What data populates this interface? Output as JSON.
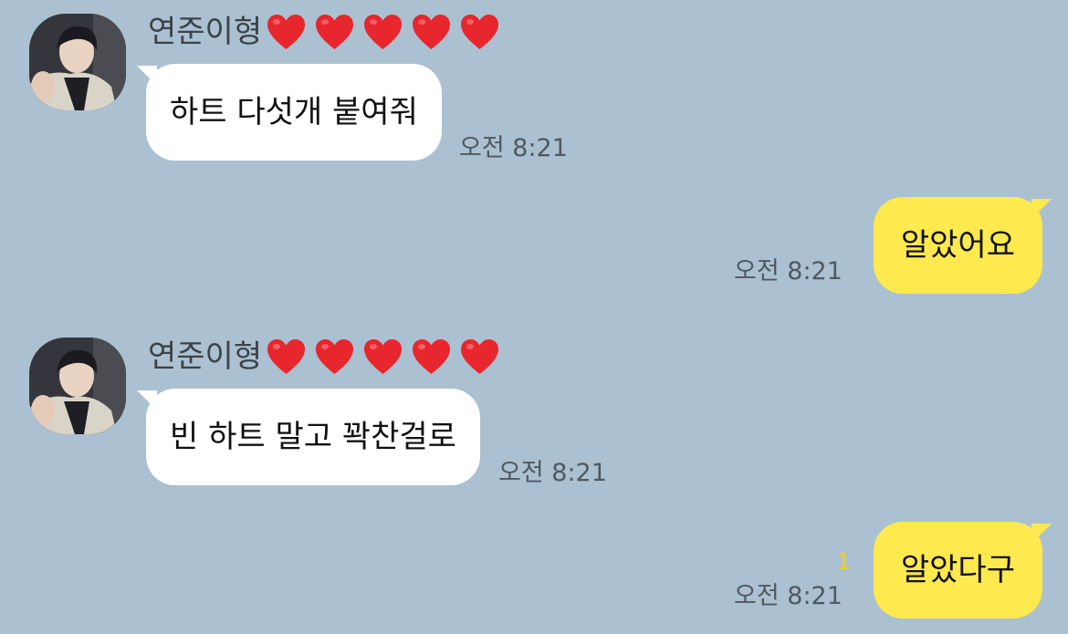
{
  "sender": {
    "name": "연준이형",
    "heart_count": 5,
    "heart_color": "#e8262d"
  },
  "messages": [
    {
      "direction": "in",
      "text": "하트 다섯개 붙여줘",
      "time": "오전 8:21"
    },
    {
      "direction": "out",
      "text": "알았어요",
      "time": "오전 8:21"
    },
    {
      "direction": "in",
      "text": "빈 하트 말고 꽉찬걸로",
      "time": "오전 8:21"
    },
    {
      "direction": "out",
      "text": "알았다구",
      "time": "오전 8:21",
      "unread": "1"
    }
  ],
  "colors": {
    "background": "#abc1d1",
    "incoming_bubble": "#ffffff",
    "outgoing_bubble": "#fee94e",
    "unread": "#f2d024"
  }
}
